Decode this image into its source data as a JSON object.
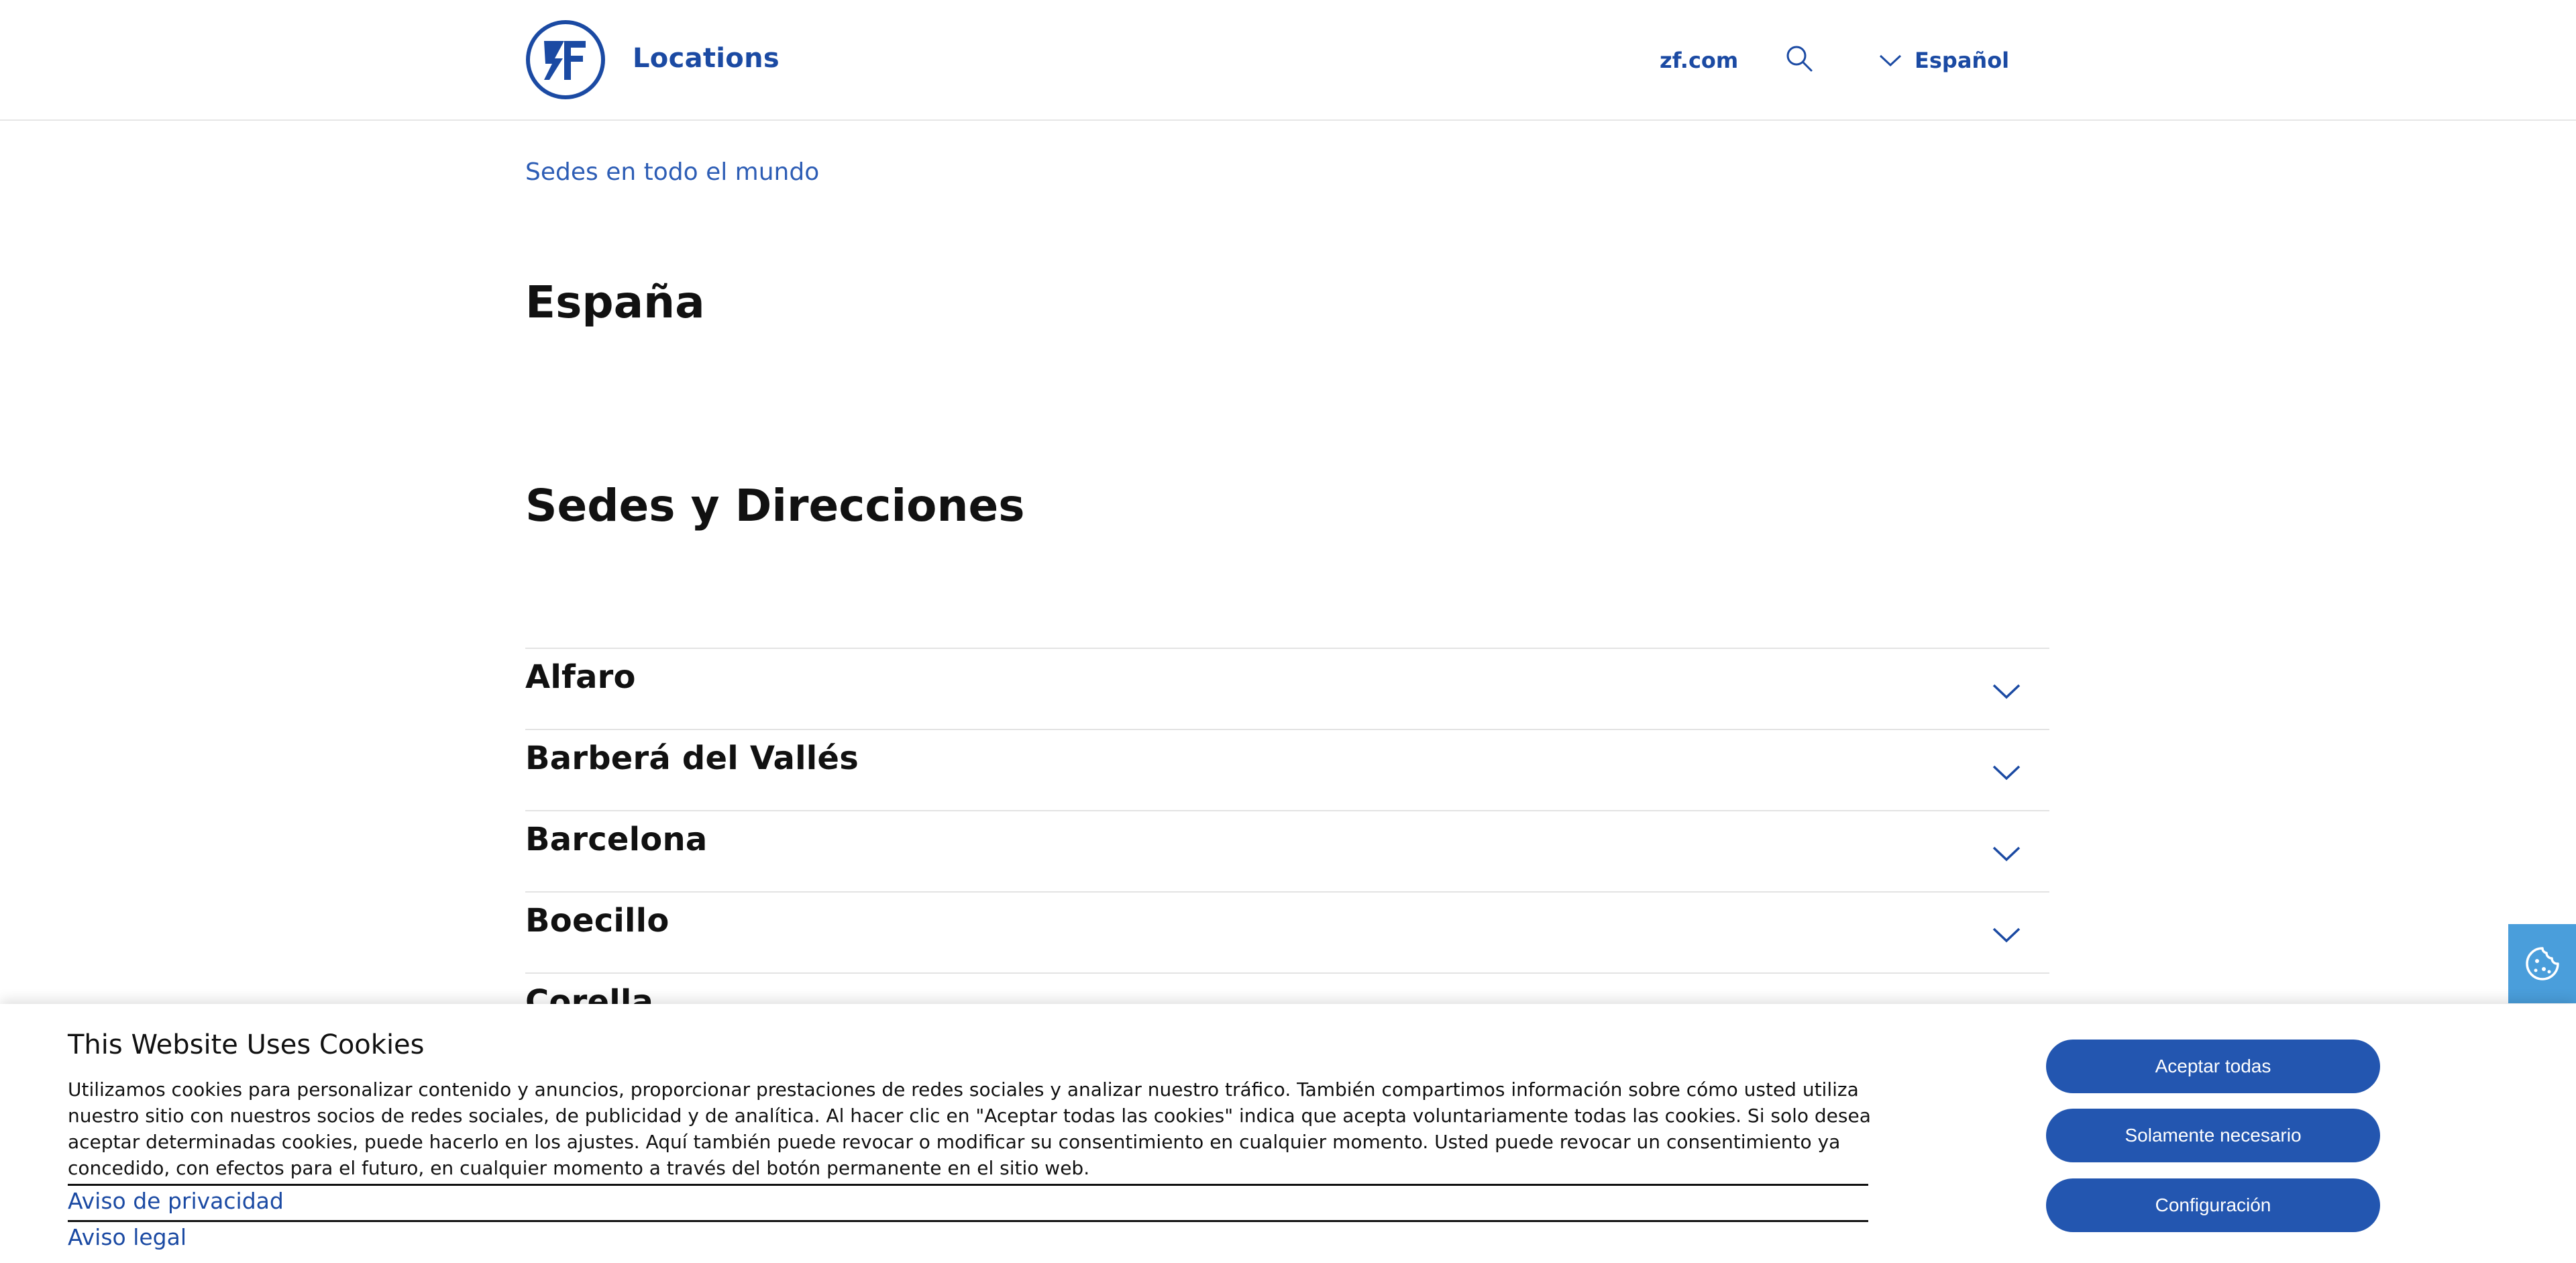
{
  "header": {
    "site_name": "Locations",
    "nav_link": "zf.com",
    "language": "Español"
  },
  "breadcrumb": "Sedes en todo el mundo",
  "country_title": "España",
  "section_title": "Sedes y Direcciones",
  "locations": [
    {
      "label": "Alfaro"
    },
    {
      "label": "Barberá del Vallés"
    },
    {
      "label": "Barcelona"
    },
    {
      "label": "Boecillo"
    },
    {
      "label": "Corella"
    }
  ],
  "cookie_banner": {
    "title": "This Website Uses Cookies",
    "text": "Utilizamos cookies para personalizar contenido y anuncios, proporcionar prestaciones de redes sociales y analizar nuestro tráfico. También compartimos información sobre cómo usted utiliza nuestro sitio con nuestros socios de redes sociales, de publicidad y de analítica. Al hacer clic en \"Aceptar todas las cookies\" indica que acepta voluntariamente todas las cookies. Si solo desea aceptar determinadas cookies, puede hacerlo en los ajustes. Aquí también puede revocar o modificar su consentimiento en cualquier momento. Usted puede revocar un consentimiento ya concedido, con efectos para el futuro, en cualquier momento a través del botón permanente en el sitio web.",
    "privacy_link": "Aviso de privacidad",
    "legal_link": "Aviso legal",
    "accept_all": "Aceptar todas",
    "only_necessary": "Solamente necesario",
    "settings": "Configuración"
  },
  "colors": {
    "brand_blue": "#1b4aa3",
    "button_blue": "#2356b0",
    "cookie_tab": "#4a9edb"
  },
  "icons": {
    "logo": "zf-logo",
    "search": "search-icon",
    "language_chevron": "chevron-down-icon",
    "accordion_chevron": "chevron-down-icon",
    "cookie_settings": "cookie-icon"
  }
}
